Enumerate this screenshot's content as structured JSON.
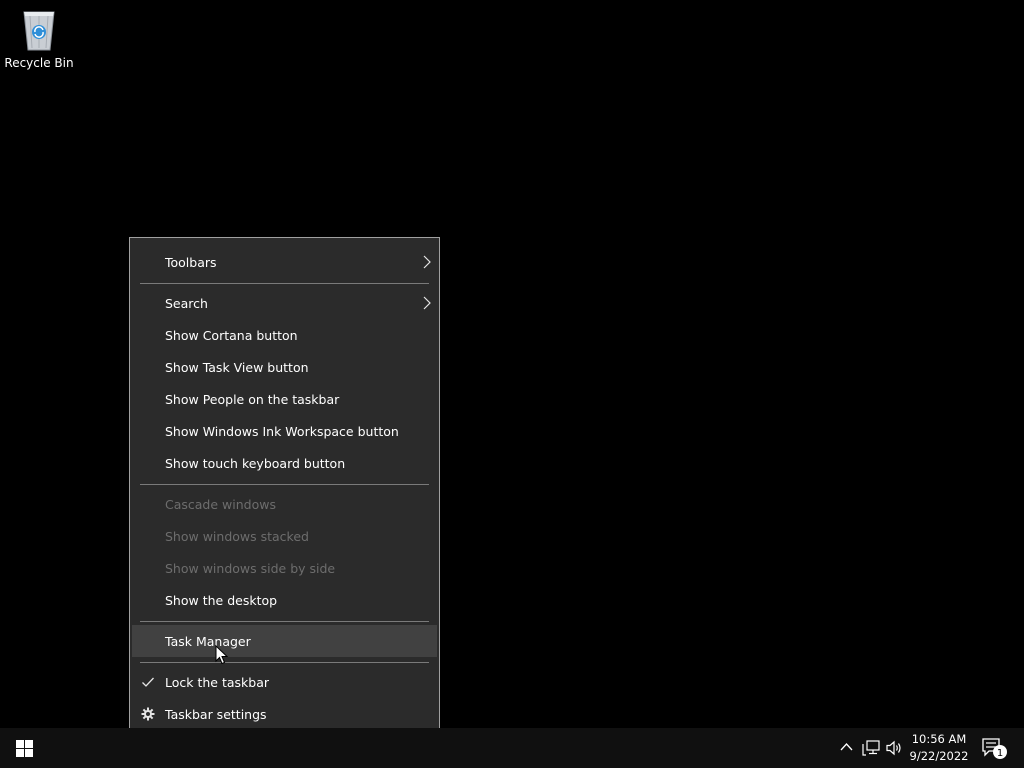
{
  "desktop": {
    "recycle_bin_label": "Recycle Bin"
  },
  "context_menu": {
    "items": {
      "toolbars": "Toolbars",
      "search": "Search",
      "show_cortana": "Show Cortana button",
      "show_task_view": "Show Task View button",
      "show_people": "Show People on the taskbar",
      "show_ink": "Show Windows Ink Workspace button",
      "show_touch_keyboard": "Show touch keyboard button",
      "cascade": "Cascade windows",
      "stacked": "Show windows stacked",
      "side_by_side": "Show windows side by side",
      "show_desktop": "Show the desktop",
      "task_manager": "Task Manager",
      "lock_taskbar": "Lock the taskbar",
      "taskbar_settings": "Taskbar settings"
    },
    "disabled_items": [
      "Cascade windows",
      "Show windows stacked",
      "Show windows side by side"
    ],
    "highlighted_item": "Task Manager",
    "checked_item": "Lock the taskbar"
  },
  "taskbar": {
    "clock_time": "10:56 AM",
    "clock_date": "9/22/2022",
    "notification_count": "1",
    "icons": [
      "windows-start-icon",
      "chevron-up-icon",
      "network-icon",
      "volume-icon",
      "action-center-icon"
    ]
  },
  "colors": {
    "desktop_bg": "#000000",
    "menu_bg": "#2b2b2b",
    "menu_hover": "#414141",
    "menu_border": "#a0a0a0",
    "disabled_text": "#6d6d6d",
    "taskbar_bg": "#101010"
  }
}
